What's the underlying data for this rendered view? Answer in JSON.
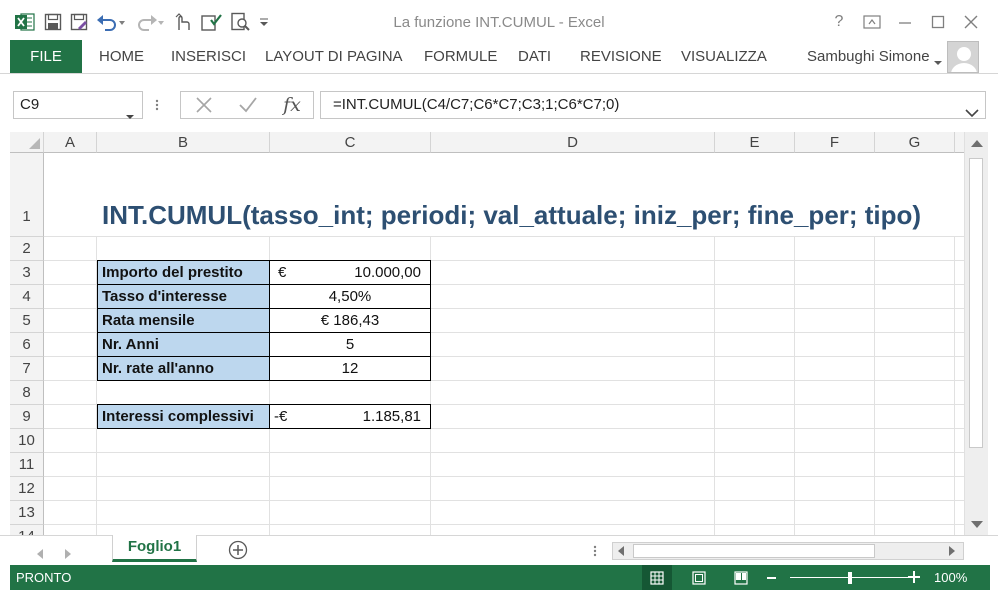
{
  "window": {
    "title": "La funzione INT.CUMUL - Excel",
    "help": "?"
  },
  "ribbon": {
    "tabs": [
      "FILE",
      "HOME",
      "INSERISCI",
      "LAYOUT DI PAGINA",
      "FORMULE",
      "DATI",
      "REVISIONE",
      "VISUALIZZA"
    ],
    "user": "Sambughi Simone"
  },
  "formula_bar": {
    "name_box": "C9",
    "formula": "=INT.CUMUL(C4/C7;C6*C7;C3;1;C6*C7;0)"
  },
  "grid": {
    "columns": [
      "A",
      "B",
      "C",
      "D",
      "E",
      "F",
      "G"
    ],
    "rows": [
      "1",
      "2",
      "3",
      "4",
      "5",
      "6",
      "7",
      "8",
      "9",
      "10",
      "11",
      "12",
      "13",
      "14"
    ],
    "title": "INT.CUMUL(tasso_int; periodi; val_attuale; iniz_per; fine_per; tipo)",
    "table": [
      {
        "label": "Importo del prestito",
        "currency": "€",
        "number": "10.000,00"
      },
      {
        "label": "Tasso d'interesse",
        "value": "4,50%"
      },
      {
        "label": "Rata mensile",
        "value": "€ 186,43"
      },
      {
        "label": "Nr. Anni",
        "value": "5"
      },
      {
        "label": "Nr. rate all'anno",
        "value": "12"
      }
    ],
    "result": {
      "label": "Interessi complessivi",
      "currency": "-€",
      "number": "1.185,81"
    }
  },
  "sheets": {
    "active": "Foglio1"
  },
  "status_bar": {
    "ready": "PRONTO",
    "zoom": "100%"
  },
  "colors": {
    "excel_green": "#217346",
    "label_fill": "#bdd7ee",
    "title_text": "#2d4f72"
  }
}
